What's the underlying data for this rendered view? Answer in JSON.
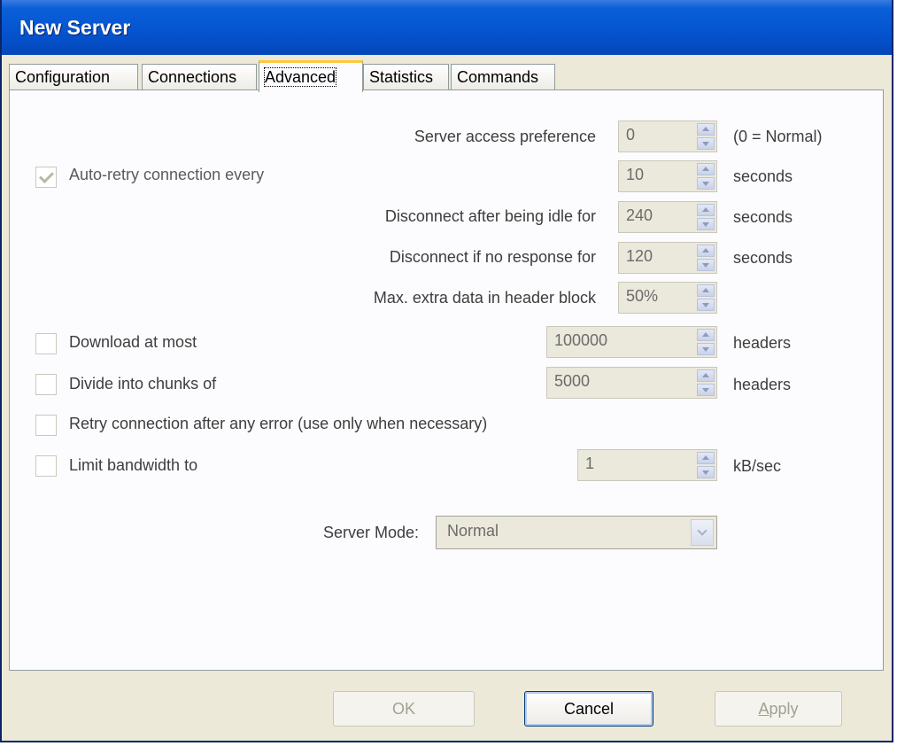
{
  "window": {
    "title": "New Server"
  },
  "tabs": [
    {
      "label": "Configuration"
    },
    {
      "label": "Connections"
    },
    {
      "label": "Advanced",
      "active": true
    },
    {
      "label": "Statistics"
    },
    {
      "label": "Commands"
    }
  ],
  "fields": {
    "access_pref": {
      "label": "Server access preference",
      "value": "0",
      "unit": "(0 = Normal)"
    },
    "auto_retry": {
      "label": "Auto-retry connection every",
      "checked": true,
      "value": "10",
      "unit": "seconds"
    },
    "idle": {
      "label": "Disconnect after being idle for",
      "value": "240",
      "unit": "seconds"
    },
    "no_response": {
      "label": "Disconnect if no response for",
      "value": "120",
      "unit": "seconds"
    },
    "extra_data": {
      "label": "Max. extra data in header block",
      "value": "50%"
    },
    "download_most": {
      "label": "Download at most",
      "checked": false,
      "value": "100000",
      "unit": "headers"
    },
    "chunks": {
      "label": "Divide into chunks of",
      "checked": false,
      "value": "5000",
      "unit": "headers"
    },
    "retry_any": {
      "label": "Retry connection after any error (use only when necessary)",
      "checked": false
    },
    "bandwidth": {
      "label": "Limit bandwidth to",
      "checked": false,
      "value": "1",
      "unit": "kB/sec"
    },
    "server_mode": {
      "label": "Server Mode:",
      "value": "Normal"
    }
  },
  "buttons": {
    "ok": "OK",
    "cancel": "Cancel",
    "apply_first": "A",
    "apply_rest": "pply"
  },
  "colors": {
    "titlebar": "#0553d0",
    "active_tab_accent": "#ffc83c",
    "face": "#ece9d8"
  },
  "icons": {
    "spin_up": "up-arrow-icon",
    "spin_down": "down-arrow-icon",
    "dropdown": "chevron-down-icon",
    "check": "checkmark-icon"
  }
}
